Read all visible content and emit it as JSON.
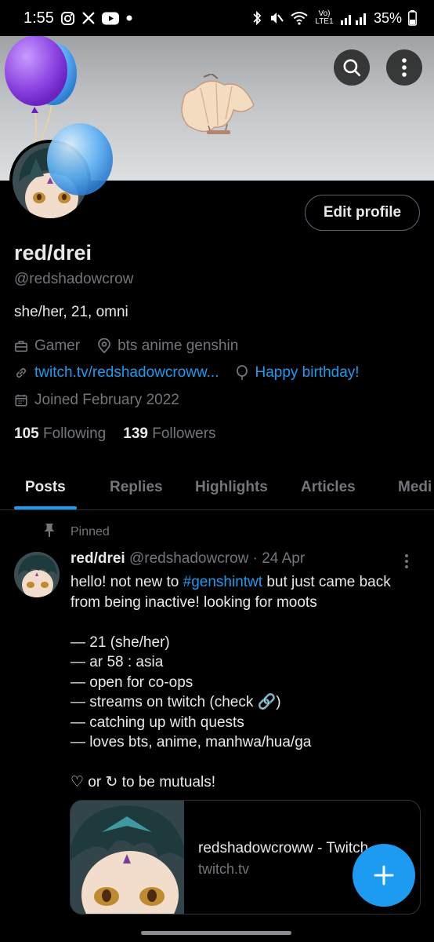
{
  "status_bar": {
    "time": "1:55",
    "notification_icons": [
      "instagram-icon",
      "x-icon",
      "youtube-icon",
      "dot-icon"
    ],
    "network_label": "Vo) LTE1",
    "battery": "35%"
  },
  "banner": {
    "bg_colors": [
      "#9fa2a5",
      "#dcdfe1"
    ],
    "search_icon": "search-icon",
    "more_icon": "more-vertical-icon"
  },
  "profile": {
    "edit_button": "Edit profile",
    "display_name": "red/drei",
    "handle": "@redshadowcrow",
    "bio": "she/her, 21, omni",
    "category": "Gamer",
    "location": "bts anime genshin",
    "website": "twitch.tv/redshadowcroww...",
    "birthday": "Happy birthday!",
    "joined": "Joined February 2022",
    "following_count": "105",
    "following_label": "Following",
    "followers_count": "139",
    "followers_label": "Followers"
  },
  "tabs": [
    {
      "label": "Posts",
      "active": true
    },
    {
      "label": "Replies",
      "active": false
    },
    {
      "label": "Highlights",
      "active": false
    },
    {
      "label": "Articles",
      "active": false
    },
    {
      "label": "Medi",
      "active": false
    }
  ],
  "post": {
    "pinned_label": "Pinned",
    "name": "red/drei",
    "handle": "@redshadowcrow",
    "separator": "·",
    "date": "24 Apr",
    "line1_pre": "hello! not new to ",
    "line1_hashtag": "#genshintwt",
    "line1_post": " but just came back",
    "line2": "from being inactive! looking for moots",
    "line3": "— 21 (she/her)",
    "line4": "— ar 58 : asia",
    "line5": "— open for co-ops",
    "line6": "— streams on twitch (check 🔗)",
    "line7": "— catching up with quests",
    "line8": "— loves bts, anime, manhwa/hua/ga",
    "line9": "♡ or ↻ to be mutuals!",
    "card_title": "redshadowcroww - Twitch",
    "card_domain": "twitch.tv"
  },
  "colors": {
    "accent": "#1d9bf0",
    "text_primary": "#e7e9ea",
    "text_secondary": "#71767b",
    "border": "#2f3336"
  }
}
